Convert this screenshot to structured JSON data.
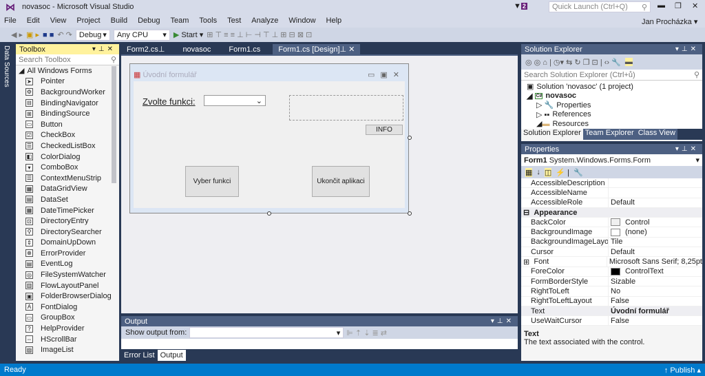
{
  "window": {
    "title": "novasoc - Microsoft Visual Studio",
    "notifications": "2",
    "quick_launch_placeholder": "Quick Launch (Ctrl+Q)",
    "user": "Jan Procházka"
  },
  "menu": [
    "File",
    "Edit",
    "View",
    "Project",
    "Build",
    "Debug",
    "Team",
    "Tools",
    "Test",
    "Analyze",
    "Window",
    "Help"
  ],
  "toolbar": {
    "config": "Debug",
    "platform": "Any CPU",
    "start": "Start"
  },
  "side_strip": "Data Sources",
  "toolbox": {
    "title": "Toolbox",
    "search_placeholder": "Search Toolbox",
    "group": "All Windows Forms",
    "items": [
      "Pointer",
      "BackgroundWorker",
      "BindingNavigator",
      "BindingSource",
      "Button",
      "CheckBox",
      "CheckedListBox",
      "ColorDialog",
      "ComboBox",
      "ContextMenuStrip",
      "DataGridView",
      "DataSet",
      "DateTimePicker",
      "DirectoryEntry",
      "DirectorySearcher",
      "DomainUpDown",
      "ErrorProvider",
      "EventLog",
      "FileSystemWatcher",
      "FlowLayoutPanel",
      "FolderBrowserDialog",
      "FontDialog",
      "GroupBox",
      "HelpProvider",
      "HScrollBar",
      "ImageList"
    ]
  },
  "tabs": [
    {
      "label": "Form2.cs"
    },
    {
      "label": "novasoc"
    },
    {
      "label": "Form1.cs"
    },
    {
      "label": "Form1.cs [Design]",
      "active": true
    }
  ],
  "form": {
    "title": "Úvodní formulář",
    "label": "Zvolte funkci:",
    "info_button": "INFO",
    "select_button": "Vyber funkci",
    "exit_button": "Ukončit aplikaci"
  },
  "output": {
    "title": "Output",
    "show_from": "Show output from:",
    "tabs": [
      "Error List",
      "Output"
    ]
  },
  "solution_explorer": {
    "title": "Solution Explorer",
    "search_placeholder": "Search Solution Explorer (Ctrl+ů)",
    "tree": [
      "Solution 'novasoc' (1 project)",
      "novasoc",
      "Properties",
      "References",
      "Resources"
    ],
    "tabs": [
      "Solution Explorer",
      "Team Explorer",
      "Class View"
    ]
  },
  "properties": {
    "title": "Properties",
    "object": "Form1",
    "type": "System.Windows.Forms.Form",
    "rows": [
      {
        "name": "AccessibleDescription",
        "value": ""
      },
      {
        "name": "AccessibleName",
        "value": ""
      },
      {
        "name": "AccessibleRole",
        "value": "Default"
      },
      {
        "name": "Appearance",
        "category": true
      },
      {
        "name": "BackColor",
        "value": "Control",
        "swatch": "#f0f0f0"
      },
      {
        "name": "BackgroundImage",
        "value": "(none)",
        "swatch": "#ffffff"
      },
      {
        "name": "BackgroundImageLayout",
        "value": "Tile"
      },
      {
        "name": "Cursor",
        "value": "Default"
      },
      {
        "name": "Font",
        "value": "Microsoft Sans Serif; 8,25pt",
        "expand": true
      },
      {
        "name": "ForeColor",
        "value": "ControlText",
        "swatch": "#000000"
      },
      {
        "name": "FormBorderStyle",
        "value": "Sizable"
      },
      {
        "name": "RightToLeft",
        "value": "No"
      },
      {
        "name": "RightToLeftLayout",
        "value": "False"
      },
      {
        "name": "Text",
        "value": "Úvodní formulář",
        "bold": true
      },
      {
        "name": "UseWaitCursor",
        "value": "False"
      }
    ],
    "desc_title": "Text",
    "desc": "The text associated with the control."
  },
  "status": {
    "left": "Ready",
    "publish": "Publish"
  }
}
